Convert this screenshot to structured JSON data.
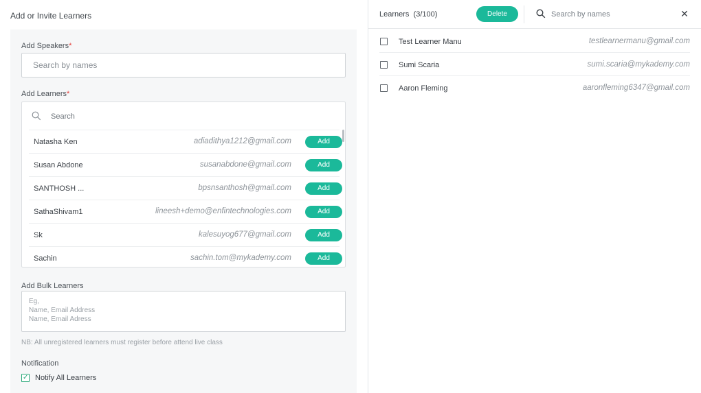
{
  "left": {
    "title": "Add or Invite Learners",
    "speakers": {
      "label": "Add Speakers",
      "required_mark": "*",
      "placeholder": "Search by names"
    },
    "learners": {
      "label": "Add Learners",
      "required_mark": "*",
      "search_placeholder": "Search",
      "add_label": "Add",
      "rows": [
        {
          "name": "Natasha Ken",
          "email": "adiadithya1212@gmail.com"
        },
        {
          "name": "Susan Abdone",
          "email": "susanabdone@gmail.com"
        },
        {
          "name": "SANTHOSH ...",
          "email": "bpsnsanthosh@gmail.com"
        },
        {
          "name": "SathaShivam1",
          "email": "lineesh+demo@enfintechnologies.com"
        },
        {
          "name": "Sk",
          "email": "kalesuyog677@gmail.com"
        },
        {
          "name": "Sachin",
          "email": "sachin.tom@mykademy.com"
        }
      ]
    },
    "bulk": {
      "label": "Add Bulk Learners",
      "placeholder_lines": [
        "Eg,",
        "Name, Email Address",
        "Name, Email Adress"
      ]
    },
    "note": "NB: All unregistered learners must register before attend live class",
    "notification": {
      "label": "Notification",
      "checkbox_label": "Notify All Learners",
      "checked": true
    }
  },
  "right": {
    "title": "Learners",
    "count": "(3/100)",
    "delete_label": "Delete",
    "search_placeholder": "Search by names",
    "close_glyph": "✕",
    "rows": [
      {
        "name": "Test Learner Manu",
        "email": "testlearnermanu@gmail.com",
        "checked": false
      },
      {
        "name": "Sumi Scaria",
        "email": "sumi.scaria@mykademy.com",
        "checked": false
      },
      {
        "name": "Aaron Fleming",
        "email": "aaronfleming6347@gmail.com",
        "checked": false
      }
    ]
  },
  "colors": {
    "accent": "#1bb99a",
    "required": "#e53935",
    "check": "#2aa97a"
  },
  "icons": {
    "search": "search-icon",
    "close": "close-icon",
    "check": "check-icon"
  }
}
